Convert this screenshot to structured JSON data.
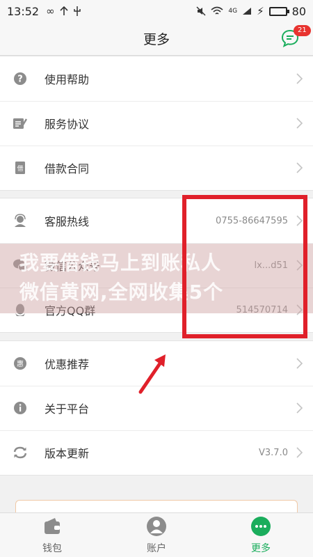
{
  "status": {
    "time": "13:52",
    "battery": "80",
    "network": "4G"
  },
  "nav": {
    "title": "更多",
    "badge": "21"
  },
  "groups": [
    {
      "rows": [
        {
          "label": "使用帮助",
          "icon": "help-icon"
        },
        {
          "label": "服务协议",
          "icon": "agreement-icon"
        },
        {
          "label": "借款合同",
          "icon": "contract-icon"
        }
      ]
    },
    {
      "rows": [
        {
          "label": "客服热线",
          "value": "0755-86647595",
          "icon": "customer-service-icon"
        },
        {
          "label": "微信公众号",
          "value": "lx...d51",
          "icon": "wechat-icon"
        },
        {
          "label": "官方QQ群",
          "value": "514570714",
          "icon": "qq-icon"
        }
      ]
    },
    {
      "rows": [
        {
          "label": "优惠推荐",
          "icon": "discount-icon"
        },
        {
          "label": "关于平台",
          "icon": "info-icon"
        },
        {
          "label": "版本更新",
          "value": "V3.7.0",
          "icon": "refresh-icon"
        }
      ]
    }
  ],
  "watermark": {
    "line1": "我要借钱马上到账私人",
    "line2": "微信黄网,全网收集5个"
  },
  "tabs": [
    {
      "label": "钱包",
      "icon": "wallet-icon"
    },
    {
      "label": "账户",
      "icon": "account-icon"
    },
    {
      "label": "更多",
      "icon": "more-icon"
    }
  ],
  "colors": {
    "accent": "#1aad5c",
    "badge": "#e8332f",
    "highlight": "#e0202a"
  }
}
